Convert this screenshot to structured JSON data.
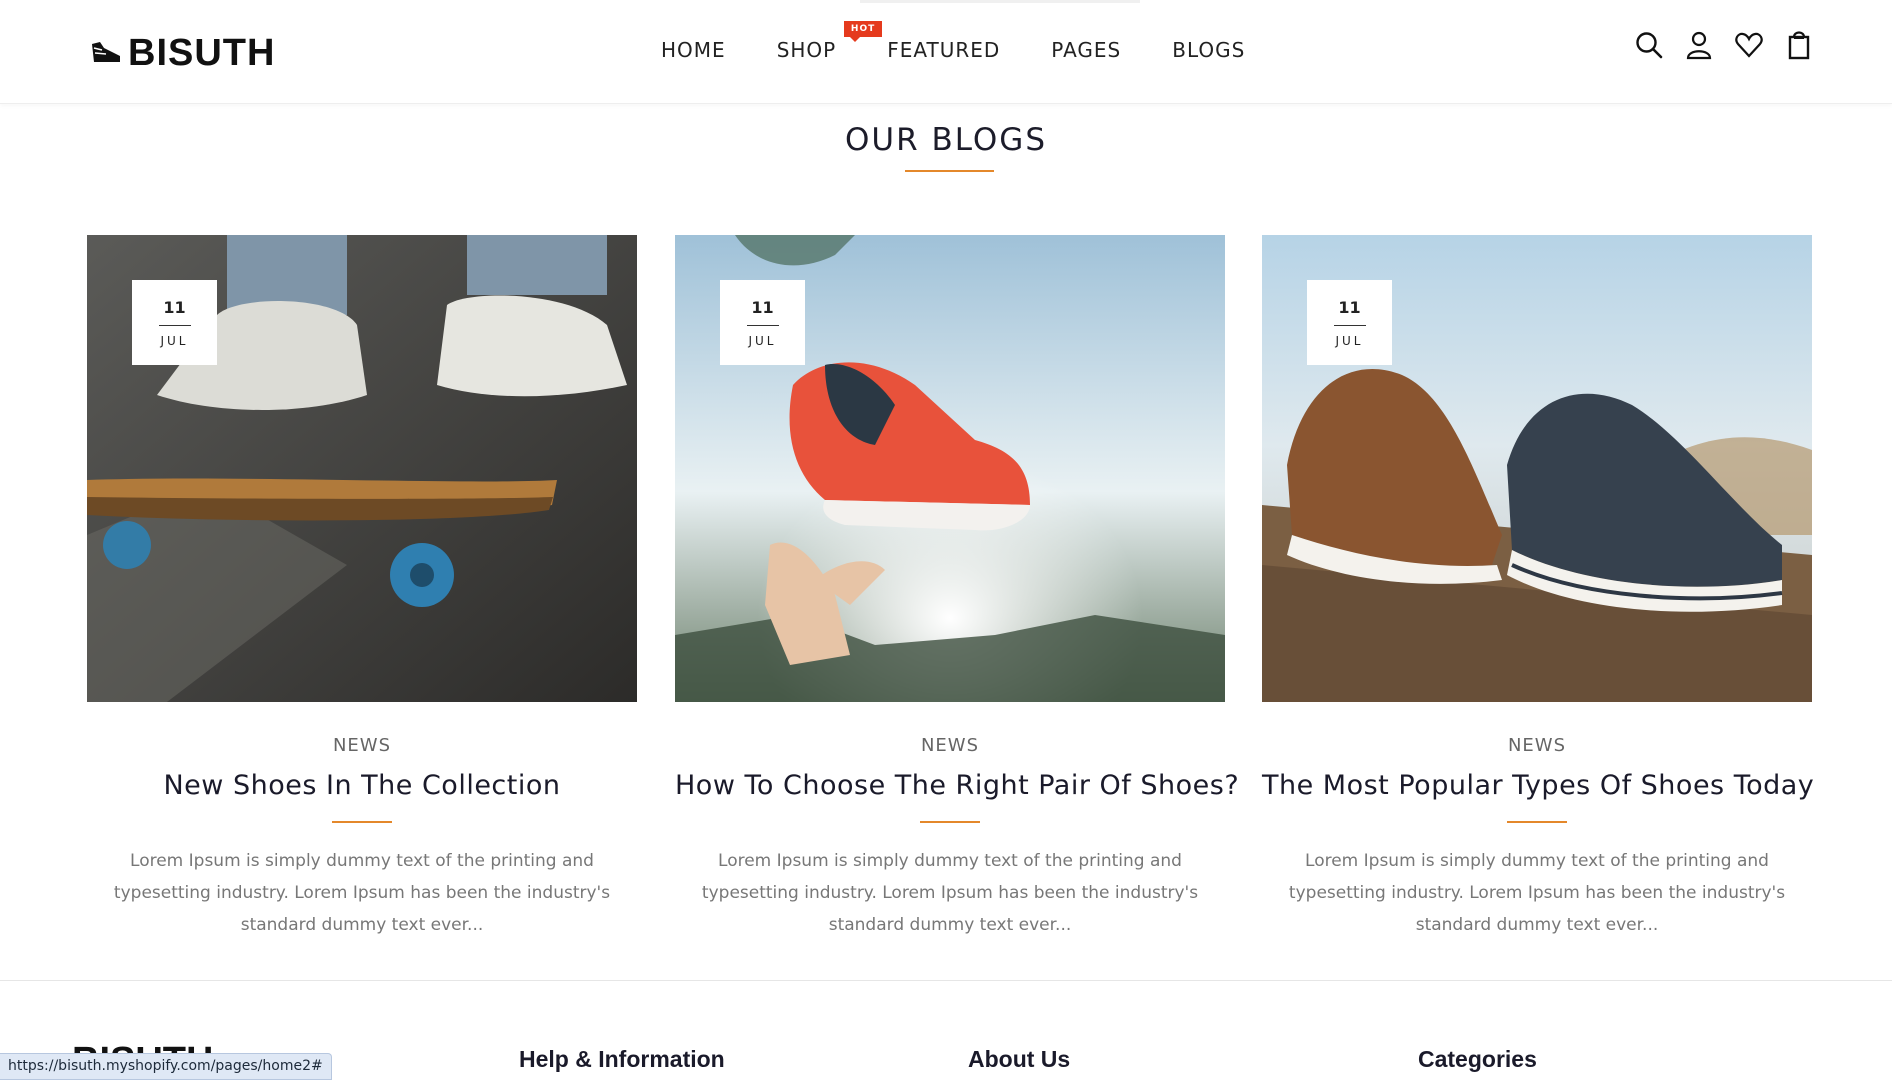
{
  "header": {
    "logo_text": "BISUTH",
    "nav": [
      {
        "label": "HOME"
      },
      {
        "label": "SHOP",
        "badge": "HOT"
      },
      {
        "label": "FEATURED"
      },
      {
        "label": "PAGES"
      },
      {
        "label": "BLOGS"
      }
    ],
    "icons": [
      "search-icon",
      "user-icon",
      "heart-icon",
      "shopping-bag-icon"
    ]
  },
  "section": {
    "title": "OUR BLOGS"
  },
  "posts": [
    {
      "day": "11",
      "month": "JUL",
      "category": "NEWS",
      "title": "New Shoes In The Collection",
      "excerpt": "Lorem Ipsum is simply dummy text of the printing and typesetting industry. Lorem Ipsum has been the industry's standard dummy text ever..."
    },
    {
      "day": "11",
      "month": "JUL",
      "category": "NEWS",
      "title": "How To Choose The Right Pair Of Shoes?",
      "excerpt": "Lorem Ipsum is simply dummy text of the printing and typesetting industry. Lorem Ipsum has been the industry's standard dummy text ever..."
    },
    {
      "day": "11",
      "month": "JUL",
      "category": "NEWS",
      "title": "The Most Popular Types Of Shoes Today",
      "excerpt": "Lorem Ipsum is simply dummy text of the printing and typesetting industry. Lorem Ipsum has been the industry's standard dummy text ever..."
    }
  ],
  "footer": {
    "logo_text": "BISUTH",
    "headings": [
      "Help & Information",
      "About Us",
      "Categories"
    ]
  },
  "status_url": "https://bisuth.myshopify.com/pages/home2#",
  "colors": {
    "accent": "#e4882b",
    "badge": "#e53a1d",
    "text_dark": "#1a1a2a",
    "text_muted": "#777777"
  }
}
